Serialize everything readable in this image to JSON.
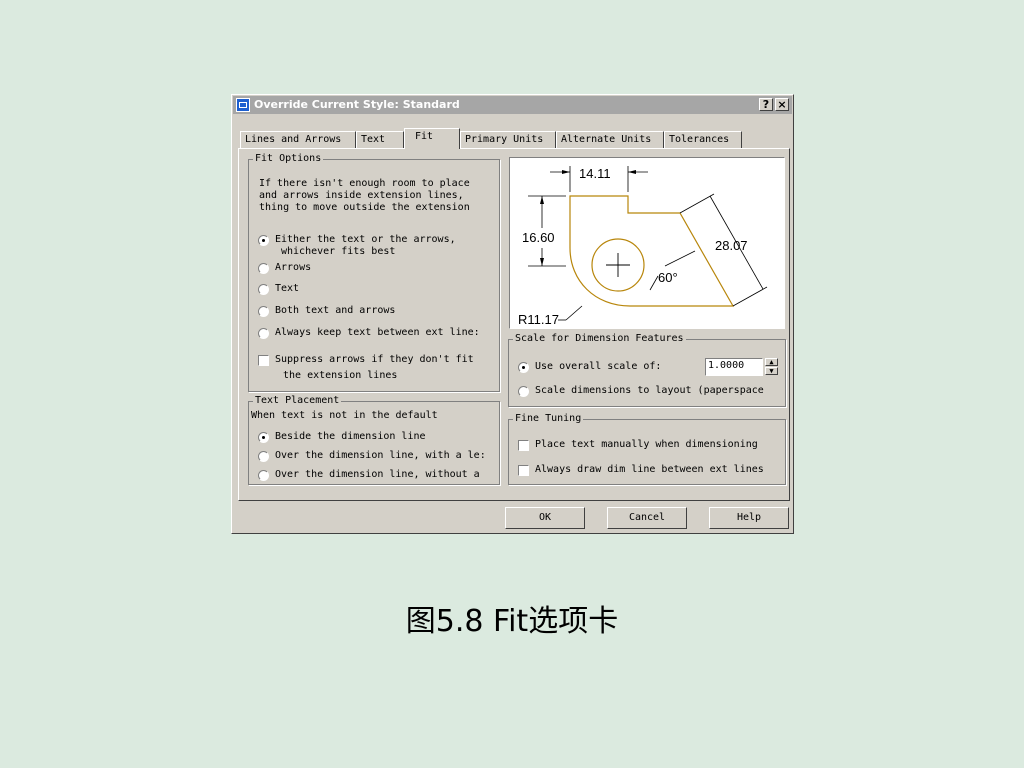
{
  "dialog": {
    "title": "Override Current Style: Standard",
    "help_btn": "?",
    "close_btn": "×"
  },
  "tabs": [
    "Lines and Arrows",
    "Text",
    "Fit",
    "Primary Units",
    "Alternate Units",
    "Tolerances"
  ],
  "fit_options": {
    "label": "Fit Options",
    "desc": [
      "If there isn't enough room to place",
      "and arrows inside extension lines,",
      "thing to move outside the extension"
    ],
    "opt1_line1": "Either the text or the arrows,",
    "opt1_line2": "whichever fits best",
    "opt2": "Arrows",
    "opt3": "Text",
    "opt4": "Both text and arrows",
    "opt5": "Always keep text between ext line:",
    "suppress_line1": "Suppress arrows if they don't fit",
    "suppress_line2": "the extension lines"
  },
  "text_placement": {
    "label": "Text Placement",
    "desc": "When text is not in the default",
    "opt1": "Beside the dimension line",
    "opt2": "Over the dimension line, with a le:",
    "opt3": "Over the dimension line, without a"
  },
  "preview": {
    "dim_top": "14.11",
    "dim_left": "16.60",
    "dim_right": "28.07",
    "angle": "60°",
    "radius": "R11.17"
  },
  "scale": {
    "label": "Scale for Dimension Features",
    "overall": "Use overall scale of:",
    "overall_value": "1.0000",
    "layout": "Scale dimensions to layout (paperspace"
  },
  "fine_tuning": {
    "label": "Fine Tuning",
    "place_manually": "Place text manually when dimensioning",
    "always_draw": "Always draw dim line between ext lines"
  },
  "buttons": {
    "ok": "OK",
    "cancel": "Cancel",
    "help": "Help"
  },
  "caption": "图5.8  Fit选项卡"
}
